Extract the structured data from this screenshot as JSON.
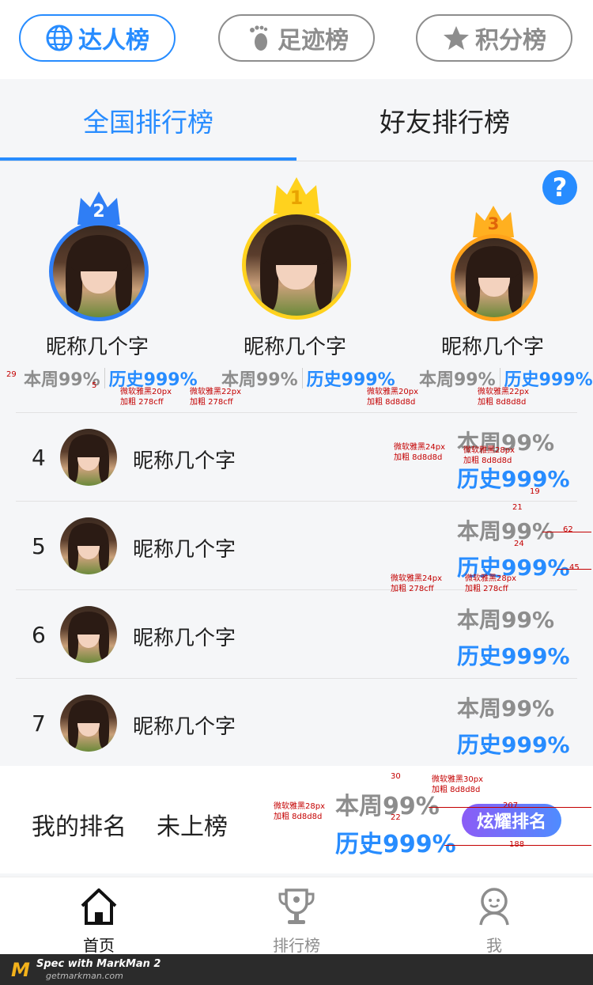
{
  "top_tabs": [
    {
      "label": "达人榜",
      "icon": "globe-icon",
      "active": true
    },
    {
      "label": "足迹榜",
      "icon": "footprint-icon",
      "active": false
    },
    {
      "label": "积分榜",
      "icon": "star-icon",
      "active": false
    }
  ],
  "sub_tabs": [
    {
      "label": "全国排行榜",
      "active": true
    },
    {
      "label": "好友排行榜",
      "active": false
    }
  ],
  "help_label": "?",
  "podium": [
    {
      "rank": "2",
      "name": "昵称几个字",
      "week": "本周99%",
      "history": "历史999%",
      "crown_color": "#2f7ef5"
    },
    {
      "rank": "1",
      "name": "昵称几个字",
      "week": "本周99%",
      "history": "历史999%",
      "crown_color": "#ffd21e"
    },
    {
      "rank": "3",
      "name": "昵称几个字",
      "week": "本周99%",
      "history": "历史999%",
      "crown_color": "#ffb020"
    }
  ],
  "rows": [
    {
      "rank": "4",
      "name": "昵称几个字",
      "week": "本周99%",
      "history": "历史999%"
    },
    {
      "rank": "5",
      "name": "昵称几个字",
      "week": "本周99%",
      "history": "历史999%"
    },
    {
      "rank": "6",
      "name": "昵称几个字",
      "week": "本周99%",
      "history": "历史999%"
    },
    {
      "rank": "7",
      "name": "昵称几个字",
      "week": "本周99%",
      "history": "历史999%"
    }
  ],
  "mine": {
    "label": "我的排名",
    "value": "未上榜",
    "week": "本周99%",
    "history": "历史999%",
    "button": "炫耀排名"
  },
  "nav": [
    {
      "label": "首页",
      "icon": "home-icon",
      "active": true
    },
    {
      "label": "排行榜",
      "icon": "trophy-icon",
      "active": false
    },
    {
      "label": "我",
      "icon": "user-icon",
      "active": false
    }
  ],
  "markman": {
    "logo": "M",
    "title": "Spec with MarkMan 2",
    "url": "getmarkman.com"
  },
  "annotations": {
    "a1": "微软雅黑20px",
    "a1b": "加粗 278cff",
    "a2": "微软雅黑22px",
    "a2b": "加粗 278cff",
    "a3": "微软雅黑20px",
    "a3b": "加粗 8d8d8d",
    "a4": "微软雅黑22px",
    "a4b": "加粗 8d8d8d",
    "a5": "微软雅黑24px",
    "a5b": "加粗 8d8d8d",
    "a6": "微软雅黑28px",
    "a6b": "加粗 8d8d8d",
    "a7": "微软雅黑24px",
    "a7b": "加粗 278cff",
    "a8": "微软雅黑28px",
    "a8b": "加粗 278cff",
    "a9": "微软雅黑30px",
    "a9b": "加粗 8d8d8d",
    "a10": "微软雅黑28px",
    "a10b": "加粗 8d8d8d",
    "d29": "29",
    "d5": "5",
    "d19": "19",
    "d21": "21",
    "d24": "24",
    "d62": "62",
    "d45": "45",
    "d30": "30",
    "d22": "22",
    "d207": "207",
    "d188": "188"
  },
  "colors": {
    "accent": "#278cff",
    "muted": "#8d8d8d"
  }
}
